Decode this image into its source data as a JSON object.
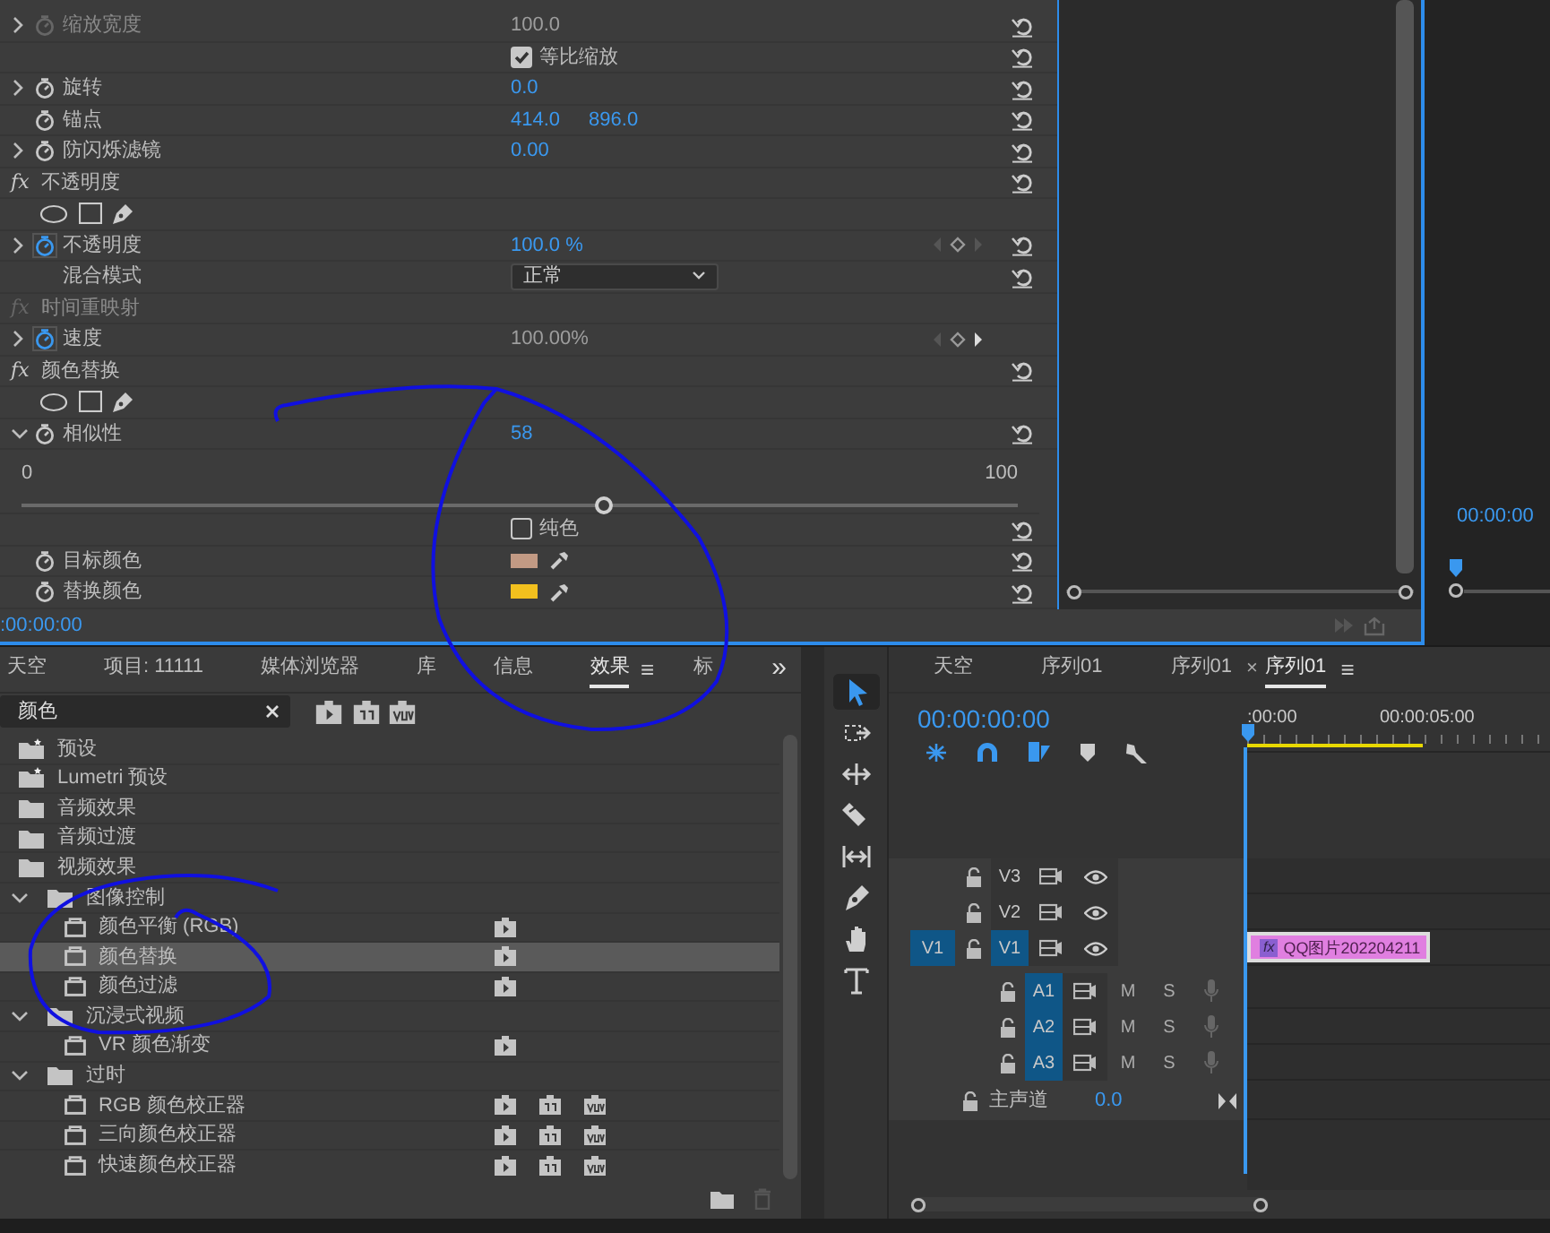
{
  "effect_controls": {
    "rows": [
      {
        "kind": "property",
        "expanded": false,
        "animated": false,
        "disabled": true,
        "label": "缩放宽度",
        "values": [
          "100.0"
        ],
        "value_link": false,
        "reset": true
      },
      {
        "kind": "checkbox",
        "label": "等比缩放",
        "checked": true,
        "reset": true
      },
      {
        "kind": "property",
        "expanded": false,
        "animated": false,
        "disabled": false,
        "label": "旋转",
        "values": [
          "0.0"
        ],
        "value_link": true,
        "reset": true
      },
      {
        "kind": "property",
        "animated": false,
        "disabled": false,
        "label": "锚点",
        "values": [
          "414.0",
          "896.0"
        ],
        "value_link": true,
        "reset": true
      },
      {
        "kind": "property",
        "expanded": false,
        "animated": false,
        "disabled": false,
        "label": "防闪烁滤镜",
        "values": [
          "0.00"
        ],
        "value_link": true,
        "reset": true
      },
      {
        "kind": "section",
        "icon_text": "fx",
        "enabled": true,
        "label": "不透明度",
        "reset": true
      },
      {
        "kind": "masks"
      },
      {
        "kind": "property",
        "expanded": false,
        "animated": true,
        "disabled": false,
        "label": "不透明度",
        "values": [
          "100.0 %"
        ],
        "value_link": true,
        "keyframes": true,
        "next_key": false,
        "reset": true
      },
      {
        "kind": "dropdown",
        "label": "混合模式",
        "value": "正常",
        "reset": true
      },
      {
        "kind": "section",
        "icon_text": "fx",
        "enabled": false,
        "label": "时间重映射",
        "reset": false
      },
      {
        "kind": "property",
        "expanded": false,
        "animated": true,
        "disabled": false,
        "label": "速度",
        "values": [
          "100.00%"
        ],
        "value_link": false,
        "keyframes": true,
        "next_key": true,
        "reset": false
      },
      {
        "kind": "section",
        "icon_text": "fx",
        "enabled": true,
        "label": "颜色替换",
        "reset": true
      },
      {
        "kind": "masks"
      },
      {
        "kind": "property",
        "expanded": true,
        "animated": false,
        "disabled": false,
        "label": "相似性",
        "values": [
          "58"
        ],
        "value_link": true,
        "reset": true
      },
      {
        "kind": "slider",
        "min": "0",
        "max": "100",
        "level": 0.584
      },
      {
        "kind": "checkbox",
        "label": "纯色",
        "checked": false,
        "reset": true
      },
      {
        "kind": "color",
        "animated": false,
        "label": "目标颜色",
        "color": "#c29a84",
        "reset": true
      },
      {
        "kind": "color",
        "animated": false,
        "label": "替换颜色",
        "color": "#f2c01e",
        "reset": true
      }
    ],
    "timecode": ":00:00:00"
  },
  "program_monitor": {
    "timecode": "00:00:00"
  },
  "effects_panel": {
    "tabs": [
      {
        "label": "天空",
        "selected": false
      },
      {
        "label": "项目: 11111",
        "selected": false
      },
      {
        "label": "媒体浏览器",
        "selected": false
      },
      {
        "label": "库",
        "selected": false
      },
      {
        "label": "信息",
        "selected": false
      },
      {
        "label": "效果",
        "selected": true,
        "menu": "≡"
      },
      {
        "label": "标",
        "selected": false
      }
    ],
    "overflow": "»",
    "search": {
      "value": "颜色"
    },
    "tree": [
      {
        "label": "预设",
        "kind": "preset-folder",
        "selected": false
      },
      {
        "label": "Lumetri 预设",
        "kind": "preset-folder",
        "selected": false
      },
      {
        "label": "音频效果",
        "kind": "folder",
        "selected": false
      },
      {
        "label": "音频过渡",
        "kind": "folder",
        "selected": false
      },
      {
        "label": "视频效果",
        "kind": "folder",
        "selected": false
      },
      {
        "label": "图像控制",
        "kind": "folder",
        "expanded": true,
        "selected": false,
        "children": [
          {
            "label": "颜色平衡 (RGB)",
            "kind": "effect",
            "selected": false,
            "accelerated": true
          },
          {
            "label": "颜色替换",
            "kind": "effect",
            "selected": true,
            "accelerated": true
          },
          {
            "label": "颜色过滤",
            "kind": "effect",
            "selected": false,
            "accelerated": true
          }
        ]
      },
      {
        "label": "沉浸式视频",
        "kind": "folder",
        "expanded": true,
        "selected": false,
        "children": [
          {
            "label": "VR 颜色渐变",
            "kind": "effect",
            "selected": false,
            "accelerated": true
          }
        ]
      },
      {
        "label": "过时",
        "kind": "folder",
        "expanded": true,
        "selected": false,
        "children": [
          {
            "label": "RGB 颜色校正器",
            "kind": "effect",
            "selected": false,
            "accelerated": true,
            "bit32": true,
            "yuv": true
          },
          {
            "label": "三向颜色校正器",
            "kind": "effect",
            "selected": false,
            "accelerated": true,
            "bit32": true,
            "yuv": true
          },
          {
            "label": "快速颜色校正器",
            "kind": "effect",
            "selected": false,
            "accelerated": true,
            "bit32": true,
            "yuv": true
          }
        ]
      }
    ]
  },
  "tools": [
    {
      "kind": "selection",
      "selected": true
    },
    {
      "kind": "track-select",
      "selected": false
    },
    {
      "kind": "ripple",
      "selected": false
    },
    {
      "kind": "razor",
      "selected": false
    },
    {
      "kind": "slip",
      "selected": false
    },
    {
      "kind": "pen",
      "selected": false
    },
    {
      "kind": "hand",
      "selected": false
    },
    {
      "kind": "type",
      "selected": false
    }
  ],
  "timeline": {
    "tabs": [
      {
        "label": "天空",
        "selected": false
      },
      {
        "label": "序列01",
        "selected": false
      },
      {
        "label": "序列01",
        "selected": false
      },
      {
        "label": "序列01",
        "selected": true,
        "close": "×",
        "menu": "≡"
      }
    ],
    "timecode": "00:00:00:00",
    "ruler": [
      ":00:00",
      "00:00:05:00"
    ],
    "video_tracks": [
      {
        "name": "V3",
        "targeted": false
      },
      {
        "name": "V2",
        "targeted": false
      },
      {
        "name": "V1",
        "targeted": true,
        "source": "V1",
        "clip": {
          "badge": "fx",
          "label": "QQ图片202204211"
        }
      }
    ],
    "audio_tracks": [
      {
        "name": "A1",
        "targeted": true,
        "mute": "M",
        "solo": "S"
      },
      {
        "name": "A2",
        "targeted": true,
        "mute": "M",
        "solo": "S"
      },
      {
        "name": "A3",
        "targeted": true,
        "mute": "M",
        "solo": "S"
      }
    ],
    "master": {
      "label": "主声道",
      "value": "0.0"
    }
  }
}
